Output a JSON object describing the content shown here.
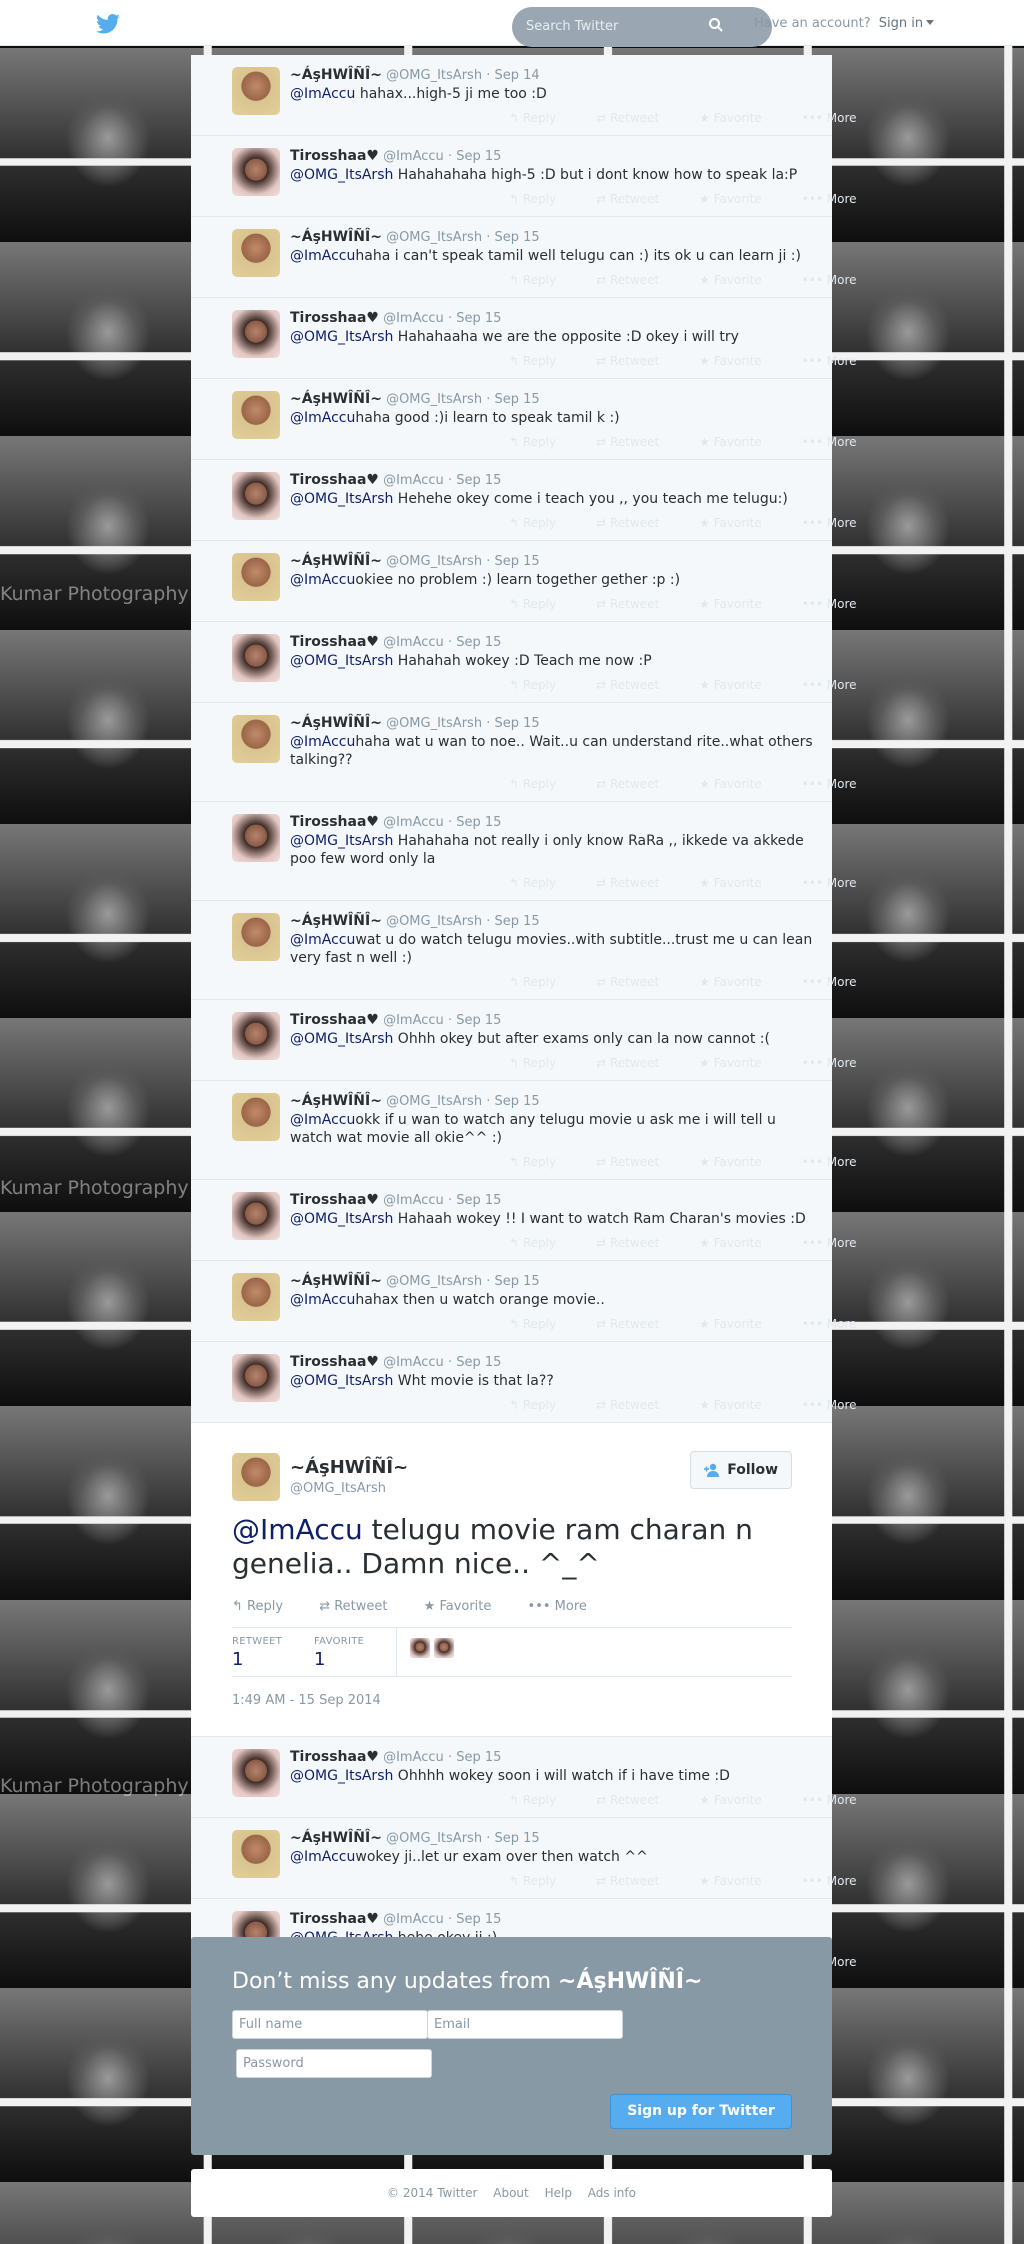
{
  "topbar": {
    "search_placeholder": "Search Twitter",
    "have_account": "Have an account?",
    "sign_in": "Sign in"
  },
  "watermark": "Kumar Photography",
  "tweets_before": [
    {
      "name": "~ÁşHWÎÑÎ~",
      "handle": "@OMG_ItsArsh",
      "date": "· Sep 14",
      "mention": "@ImAccu",
      "text": " hahax...high-5 ji me too :D",
      "av": "a"
    },
    {
      "name": "Tirosshaa♥",
      "handle": "@ImAccu",
      "date": "· Sep 15",
      "mention": "@OMG_ItsArsh",
      "text": " Hahahahaha high-5 :D but i dont know how to speak la:P",
      "av": "t"
    },
    {
      "name": "~ÁşHWÎÑÎ~",
      "handle": "@OMG_ItsArsh",
      "date": "· Sep 15",
      "mention": "@ImAccu",
      "text": "haha i can't speak tamil well telugu can :) its ok u can learn ji :)",
      "av": "a"
    },
    {
      "name": "Tirosshaa♥",
      "handle": "@ImAccu",
      "date": "· Sep 15",
      "mention": "@OMG_ItsArsh",
      "text": " Hahahaaha we are the opposite :D okey i will try",
      "av": "t"
    },
    {
      "name": "~ÁşHWÎÑÎ~",
      "handle": "@OMG_ItsArsh",
      "date": "· Sep 15",
      "mention": "@ImAccu",
      "text": "haha good :)i learn to speak tamil k :)",
      "av": "a"
    },
    {
      "name": "Tirosshaa♥",
      "handle": "@ImAccu",
      "date": "· Sep 15",
      "mention": "@OMG_ItsArsh",
      "text": " Hehehe okey come i teach you ,, you teach me telugu:)",
      "av": "t"
    },
    {
      "name": "~ÁşHWÎÑÎ~",
      "handle": "@OMG_ItsArsh",
      "date": "· Sep 15",
      "mention": "@ImAccu",
      "text": "okiee no problem :) learn together gether :p :)",
      "av": "a"
    },
    {
      "name": "Tirosshaa♥",
      "handle": "@ImAccu",
      "date": "· Sep 15",
      "mention": "@OMG_ItsArsh",
      "text": " Hahahah wokey :D Teach me now :P",
      "av": "t"
    },
    {
      "name": "~ÁşHWÎÑÎ~",
      "handle": "@OMG_ItsArsh",
      "date": "· Sep 15",
      "mention": "@ImAccu",
      "text": "haha wat u wan to noe.. Wait..u can understand rite..what others talking??",
      "av": "a"
    },
    {
      "name": "Tirosshaa♥",
      "handle": "@ImAccu",
      "date": "· Sep 15",
      "mention": "@OMG_ItsArsh",
      "text": " Hahahaha not really i only know RaRa ,, ikkede va akkede poo few word only la",
      "av": "t"
    },
    {
      "name": "~ÁşHWÎÑÎ~",
      "handle": "@OMG_ItsArsh",
      "date": "· Sep 15",
      "mention": "@ImAccu",
      "text": "wat u do watch telugu movies..with subtitle...trust me u can lean very fast n well :)",
      "av": "a"
    },
    {
      "name": "Tirosshaa♥",
      "handle": "@ImAccu",
      "date": "· Sep 15",
      "mention": "@OMG_ItsArsh",
      "text": " Ohhh okey but after exams only can la now cannot :(",
      "av": "t"
    },
    {
      "name": "~ÁşHWÎÑÎ~",
      "handle": "@OMG_ItsArsh",
      "date": "· Sep 15",
      "mention": "@ImAccu",
      "text": "okk if u wan to watch any telugu movie u ask me i will tell u watch wat movie all okie^^  :)",
      "av": "a"
    },
    {
      "name": "Tirosshaa♥",
      "handle": "@ImAccu",
      "date": "· Sep 15",
      "mention": "@OMG_ItsArsh",
      "text": " Hahaah wokey !! I want to watch Ram Charan's movies :D",
      "av": "t"
    },
    {
      "name": "~ÁşHWÎÑÎ~",
      "handle": "@OMG_ItsArsh",
      "date": "· Sep 15",
      "mention": "@ImAccu",
      "text": "hahax then u watch orange movie..",
      "av": "a"
    },
    {
      "name": "Tirosshaa♥",
      "handle": "@ImAccu",
      "date": "· Sep 15",
      "mention": "@OMG_ItsArsh",
      "text": " Wht movie is that la??",
      "av": "t"
    }
  ],
  "actions": {
    "reply": "Reply",
    "retweet": "Retweet",
    "favorite": "Favorite",
    "more": "More"
  },
  "main_tweet": {
    "name": "~ÁşHWÎÑÎ~",
    "handle": "@OMG_ItsArsh",
    "follow": "Follow",
    "mention": "@ImAccu",
    "text": " telugu movie ram charan n genelia.. Damn nice.. ^_^",
    "retweet_label": "RETWEET",
    "retweet_count": "1",
    "favorite_label": "FAVORITE",
    "favorite_count": "1",
    "timestamp": "1:49 AM - 15 Sep 2014"
  },
  "tweets_after": [
    {
      "name": "Tirosshaa♥",
      "handle": "@ImAccu",
      "date": "· Sep 15",
      "mention": "@OMG_ItsArsh",
      "text": " Ohhhh wokey soon i will watch if i have time :D",
      "av": "t"
    },
    {
      "name": "~ÁşHWÎÑÎ~",
      "handle": "@OMG_ItsArsh",
      "date": "· Sep 15",
      "mention": "@ImAccu",
      "text": "wokey ji..let ur exam over then watch ^^",
      "av": "a"
    },
    {
      "name": "Tirosshaa♥",
      "handle": "@ImAccu",
      "date": "· Sep 15",
      "mention": "@OMG_ItsArsh",
      "text": " hehe okey ji :)",
      "av": "t"
    }
  ],
  "signup": {
    "heading": "Don’t miss any updates from ",
    "heading_name": "~ÁşHWÎÑÎ~",
    "full_name": "Full name",
    "email": "Email",
    "password": "Password",
    "button": "Sign up for Twitter"
  },
  "footer": {
    "copyright": "© 2014 Twitter",
    "about": "About",
    "help": "Help",
    "ads": "Ads info"
  }
}
